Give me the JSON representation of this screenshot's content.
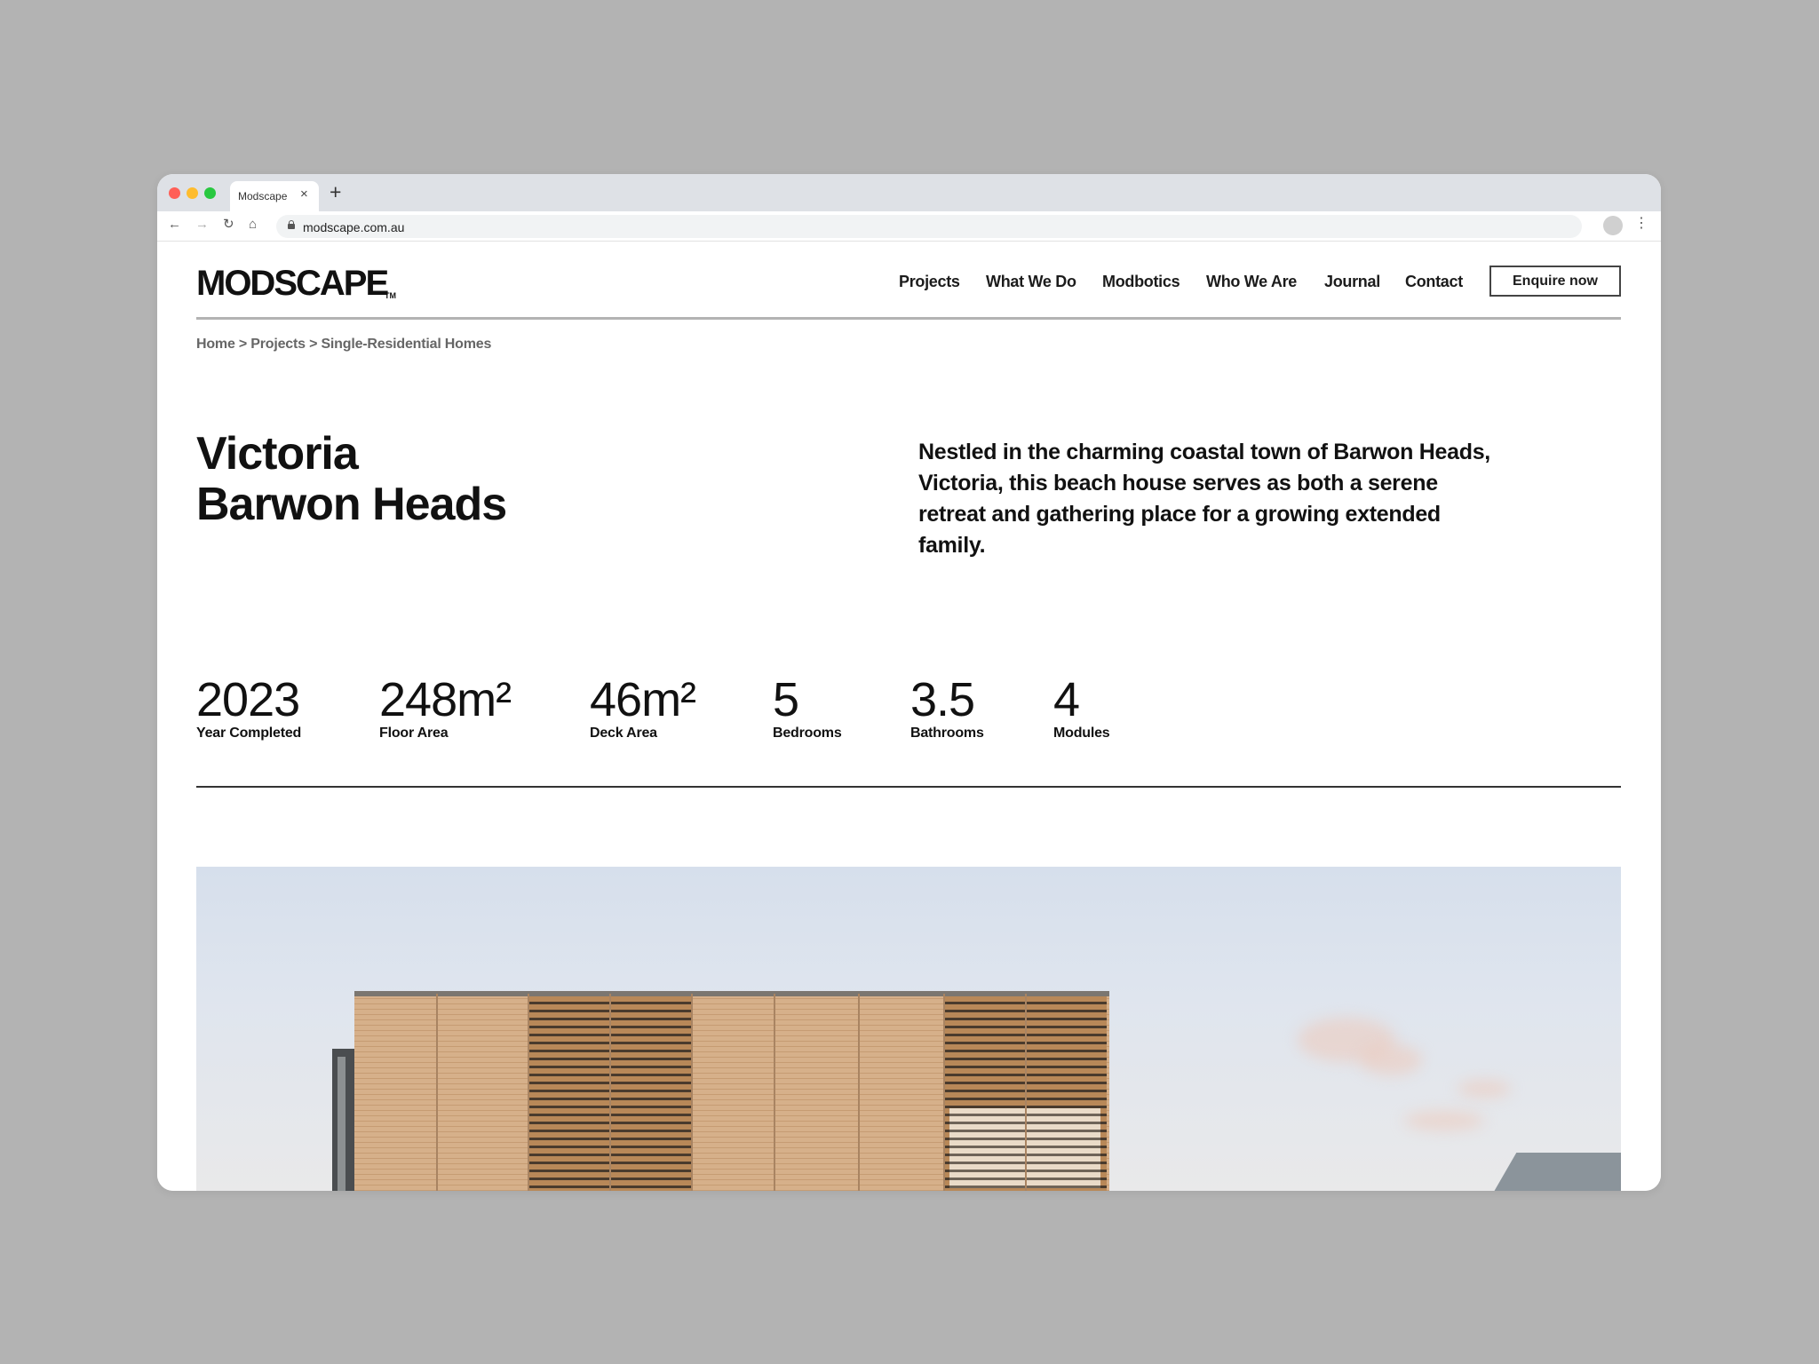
{
  "browser": {
    "tab_title": "Modscape",
    "tab_close": "×",
    "new_tab": "+",
    "url": "modscape.com.au",
    "icons": {
      "back": "←",
      "forward": "→",
      "reload": "↻",
      "home": "⌂",
      "star": "☆",
      "menu": "⋮"
    }
  },
  "site": {
    "logo": "MODSCAPE",
    "logo_tm": "TM",
    "nav": [
      "Projects",
      "What We Do",
      "Modbotics",
      "Who We Are",
      "Journal",
      "Contact"
    ],
    "cta": "Enquire now"
  },
  "breadcrumb": "Home > Projects > Single-Residential Homes",
  "project": {
    "title_line1": "Victoria",
    "title_line2": "Barwon Heads",
    "intro": "Nestled in the charming coastal town of Barwon Heads, Victoria, this beach house serves as both a serene retreat and gathering place for a growing extended family."
  },
  "stats": [
    {
      "value": "2023",
      "label": "Year Completed"
    },
    {
      "value": "248m²",
      "label": "Floor Area"
    },
    {
      "value": "46m²",
      "label": "Deck Area"
    },
    {
      "value": "5",
      "label": "Bedrooms"
    },
    {
      "value": "3.5",
      "label": "Bathrooms"
    },
    {
      "value": "4",
      "label": "Modules"
    }
  ],
  "colors": {
    "backdrop": "#b3b3b3",
    "text": "#111111",
    "timber": "#d6b08a",
    "sky": "#d6dfec"
  }
}
